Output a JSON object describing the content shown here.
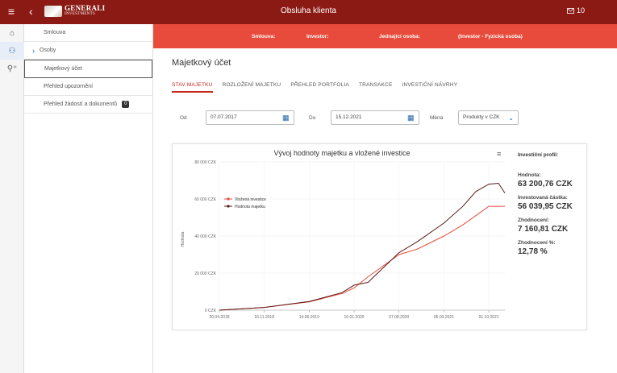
{
  "header": {
    "title": "Obsluha klienta",
    "back_glyph": "‹",
    "menu_glyph": "≡",
    "logo_line1": "GENERALI",
    "logo_line2": "INVESTMENTS",
    "mail_count": "10"
  },
  "icon_rail": [
    {
      "icon": "home-icon",
      "glyph": "⌂"
    },
    {
      "icon": "people-icon",
      "glyph": "⚇"
    },
    {
      "icon": "add-person-icon",
      "glyph": "⚲⁺"
    }
  ],
  "sidebar": {
    "items": [
      {
        "label": "Smlouva"
      },
      {
        "label": "Osoby"
      },
      {
        "label": "Majetkový účet"
      },
      {
        "label": "Přehled upozornění"
      },
      {
        "label": "Přehled žádostí a dokumentů",
        "badge": "0"
      }
    ]
  },
  "context_bar": {
    "smlouva": "Smlouva:",
    "investor": "Investor:",
    "jednajici": "Jednající osoba:",
    "role": "(Investor - Fyzická osoba)"
  },
  "main": {
    "title": "Majetkový účet",
    "tabs": [
      "STAV MAJETKU",
      "ROZLOŽENÍ MAJETKU",
      "PŘEHLED PORTFOLIA",
      "TRANSAKCE",
      "INVESTIČNÍ NÁVRHY"
    ],
    "filters": {
      "od_label": "Od",
      "od_value": "07.07.2017",
      "do_label": "Do",
      "do_value": "15.12.2021",
      "mena_label": "Měna",
      "mena_value": "Produkty v CZK"
    }
  },
  "stats": {
    "heading": "Investiční profil:",
    "hodnota_label": "Hodnota:",
    "hodnota_value": "63 200,76 CZK",
    "investovana_label": "Investovaná částka:",
    "investovana_value": "56 039,95 CZK",
    "zhodnoceni_label": "Zhodnocení:",
    "zhodnoceni_value": "7 160,81 CZK",
    "zhodnoceni_pct_label": "Zhodnocení %:",
    "zhodnoceni_pct_value": "12,78 %"
  },
  "colors": {
    "topbar": "#8b1a14",
    "redbar": "#e84b3c",
    "series_invested": "#e84b3c",
    "series_value": "#5c1a1a"
  },
  "chart_data": {
    "type": "line",
    "title": "Vývoj hodnoty majetku a vložené investice",
    "ylabel": "Hodnota",
    "ylim": [
      0,
      80000
    ],
    "yticks": [
      "0 CZK",
      "20 000 CZK",
      "40 000 CZK",
      "60 000 CZK",
      "80 000 CZK"
    ],
    "xticks": [
      "20.04.2018",
      "16.11.2018",
      "14.06.2019",
      "10.01.2020",
      "07.08.2020",
      "05.03.2021",
      "01.10.2021"
    ],
    "legend_position": "top-left",
    "x": [
      "20.04.2018",
      "16.11.2018",
      "14.06.2019",
      "15.11.2019",
      "10.01.2020",
      "15.03.2020",
      "07.08.2020",
      "01.11.2020",
      "05.03.2021",
      "01.06.2021",
      "01.08.2021",
      "01.10.2021",
      "15.11.2021",
      "15.12.2021"
    ],
    "series": [
      {
        "name": "Vložená investice",
        "values": [
          0,
          1500,
          4500,
          9000,
          12000,
          18000,
          30000,
          33000,
          40000,
          46000,
          51000,
          56040,
          56040,
          56040
        ]
      },
      {
        "name": "Hodnota majetku",
        "values": [
          0,
          1500,
          4700,
          9500,
          13500,
          15000,
          31000,
          37000,
          47000,
          56000,
          64000,
          68000,
          68500,
          63200
        ]
      }
    ]
  }
}
